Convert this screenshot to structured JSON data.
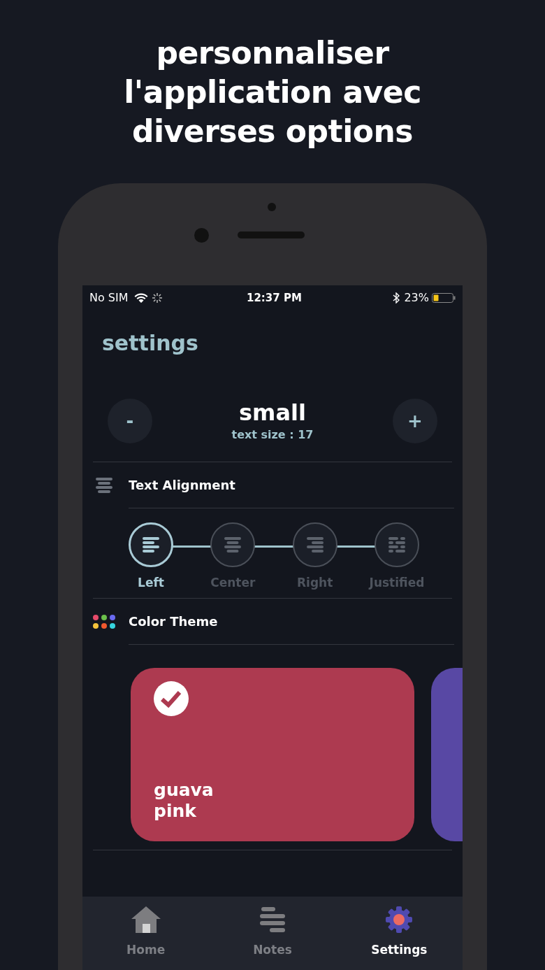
{
  "headline": "personnaliser l'application avec diverses options",
  "status_bar": {
    "carrier": "No SIM",
    "time": "12:37 PM",
    "battery": "23%"
  },
  "page_title": "settings",
  "text_size": {
    "decrease": "-",
    "increase": "+",
    "label": "small",
    "reading": "text size : 17"
  },
  "alignment": {
    "title": "Text Alignment",
    "options": [
      {
        "kind": "left",
        "label": "Left",
        "selected": true
      },
      {
        "kind": "center",
        "label": "Center",
        "selected": false
      },
      {
        "kind": "right",
        "label": "Right",
        "selected": false
      },
      {
        "kind": "justified",
        "label": "Justified",
        "selected": false
      }
    ]
  },
  "color_theme": {
    "title": "Color Theme",
    "themes": [
      {
        "lines": [
          "guava",
          "pink"
        ],
        "color": "#ad3a50",
        "selected": true
      },
      {
        "color": "#5848a4",
        "selected": false
      }
    ]
  },
  "tab_bar": {
    "items": [
      {
        "kind": "home",
        "label": "Home",
        "selected": false
      },
      {
        "kind": "notes",
        "label": "Notes",
        "selected": false
      },
      {
        "kind": "settings",
        "label": "Settings",
        "selected": true
      }
    ]
  }
}
